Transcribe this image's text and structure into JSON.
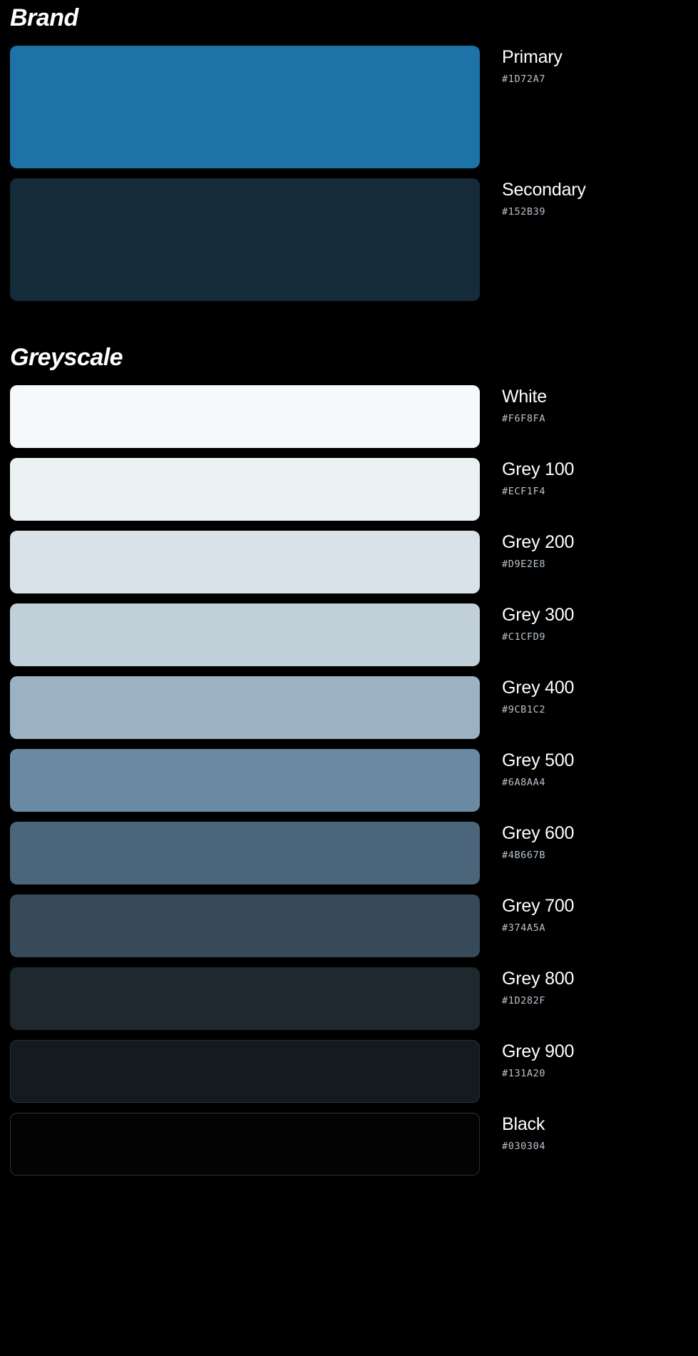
{
  "sections": [
    {
      "title": "Brand",
      "size": "tall",
      "swatches": [
        {
          "name": "Primary",
          "hex": "#1D72A7",
          "bordered": false
        },
        {
          "name": "Secondary",
          "hex": "#152B39",
          "bordered": false
        }
      ]
    },
    {
      "title": "Greyscale",
      "size": "short",
      "swatches": [
        {
          "name": "White",
          "hex": "#F6F8FA",
          "bordered": false
        },
        {
          "name": "Grey 100",
          "hex": "#ECF1F4",
          "bordered": false
        },
        {
          "name": "Grey 200",
          "hex": "#D9E2E8",
          "bordered": false
        },
        {
          "name": "Grey 300",
          "hex": "#C1CFD9",
          "bordered": false
        },
        {
          "name": "Grey 400",
          "hex": "#9CB1C2",
          "bordered": false
        },
        {
          "name": "Grey 500",
          "hex": "#6A8AA4",
          "bordered": false
        },
        {
          "name": "Grey 600",
          "hex": "#4B667B",
          "bordered": false
        },
        {
          "name": "Grey 700",
          "hex": "#374A5A",
          "bordered": false
        },
        {
          "name": "Grey 800",
          "hex": "#1D282F",
          "bordered": false
        },
        {
          "name": "Grey 900",
          "hex": "#131A20",
          "bordered": true
        },
        {
          "name": "Black",
          "hex": "#030304",
          "bordered": true
        }
      ]
    }
  ],
  "page": {
    "background": "#000000",
    "text_color": "#FFFFFF",
    "hex_text_color": "#B9C3CC"
  }
}
